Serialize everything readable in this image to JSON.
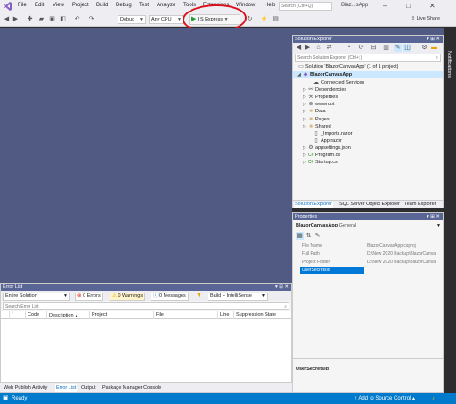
{
  "menu": {
    "items": [
      "File",
      "Edit",
      "View",
      "Project",
      "Build",
      "Debug",
      "Test",
      "Analyze",
      "Tools",
      "Extensions",
      "Window",
      "Help"
    ],
    "search_placeholder": "Search (Ctrl+Q)",
    "app_title": "Blaz...sApp"
  },
  "toolbar": {
    "config": "Debug",
    "platform": "Any CPU",
    "run_target": "IIS Express",
    "live_share": "Live Share"
  },
  "notifications": {
    "label": "Notifications"
  },
  "solution_explorer": {
    "title": "Solution Explorer",
    "search_placeholder": "Search Solution Explorer (Ctrl+;)",
    "solution_label": "Solution 'BlazorCanvasApp' (1 of 1 project)",
    "project_label": "BlazorCanvasApp",
    "items": [
      "Connected Services",
      "Dependencies",
      "Properties",
      "wwwroot",
      "Data",
      "Pages",
      "Shared",
      "_Imports.razor",
      "App.razor",
      "appsettings.json",
      "Program.cs",
      "Startup.cs"
    ],
    "tabs": [
      "Solution Explorer",
      "SQL Server Object Explorer",
      "Team Explorer"
    ]
  },
  "properties": {
    "title": "Properties",
    "object_name": "BlazorCanvasApp",
    "object_type": "General",
    "rows": [
      {
        "name": "File Name",
        "value": "BlazorCanvasApp.csproj"
      },
      {
        "name": "Full Path",
        "value": "D:\\New 2020 Backup\\BlazorCanva"
      },
      {
        "name": "Project Folder",
        "value": "D:\\New 2020 Backup\\BlazorCanva"
      },
      {
        "name": "UserSecretsId",
        "value": ""
      }
    ],
    "description_title": "UserSecretsId"
  },
  "error_list": {
    "title": "Error List",
    "scope": "Entire Solution",
    "errors": "0 Errors",
    "warnings": "0 Warnings",
    "messages": "0 Messages",
    "build_filter": "Build + IntelliSense",
    "search_placeholder": "Search Error List",
    "columns": [
      "Code",
      "Description",
      "Project",
      "File",
      "Line",
      "Suppression State"
    ]
  },
  "bottom_tabs": [
    "Web Publish Activity",
    "Error List",
    "Output",
    "Package Manager Console"
  ],
  "status": {
    "ready": "Ready",
    "source_control": "Add to Source Control"
  },
  "colors": {
    "editor_bg": "#515a82",
    "status_bar": "#007acc",
    "annotation": "#d8111c"
  }
}
